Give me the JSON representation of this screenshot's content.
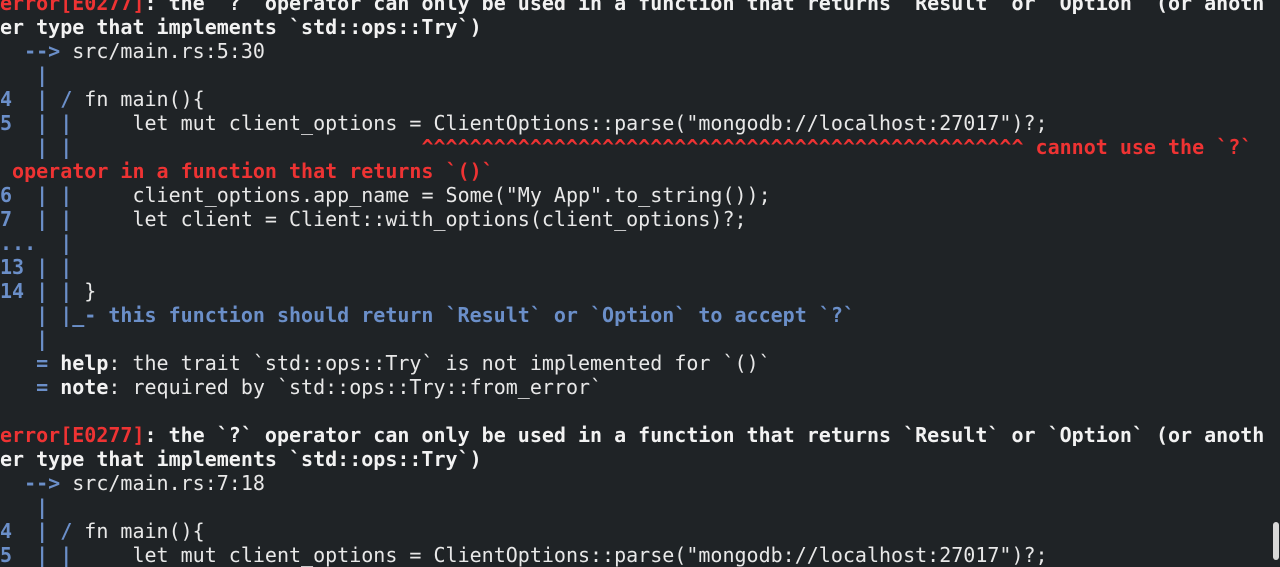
{
  "colors": {
    "background": "#1f2326",
    "error": "#ee3333",
    "gutter": "#6b8fc9",
    "text": "#e8e8e8"
  },
  "terminal": {
    "lines": [
      {
        "segments": [
          {
            "t": "error[E0277]",
            "s": "err"
          },
          {
            "t": ": the `?` operator can only be used in a function that returns `Result` or `Option` (or anoth",
            "s": "bold"
          }
        ]
      },
      {
        "segments": [
          {
            "t": "er type that implements `std::ops::Try`)",
            "s": "bold"
          }
        ]
      },
      {
        "segments": [
          {
            "t": "  --> ",
            "s": "blue"
          },
          {
            "t": "src/main.rs:5:30",
            "s": "text"
          }
        ]
      },
      {
        "segments": [
          {
            "t": "   |",
            "s": "blue"
          }
        ]
      },
      {
        "segments": [
          {
            "t": "4  | / ",
            "s": "blue"
          },
          {
            "t": "fn main(){",
            "s": "text"
          }
        ]
      },
      {
        "segments": [
          {
            "t": "5  | | ",
            "s": "blue"
          },
          {
            "t": "    let mut client_options = ClientOptions::parse(\"mongodb://localhost:27017\")?;",
            "s": "text"
          }
        ]
      },
      {
        "segments": [
          {
            "t": "   | | ",
            "s": "blue"
          },
          {
            "t": "                            ^^^^^^^^^^^^^^^^^^^^^^^^^^^^^^^^^^^^^^^^^^^^^^^^^^ cannot use the `?`",
            "s": "err"
          }
        ]
      },
      {
        "segments": [
          {
            "t": " operator in a function that returns `()`",
            "s": "err"
          }
        ]
      },
      {
        "segments": [
          {
            "t": "6  | | ",
            "s": "blue"
          },
          {
            "t": "    client_options.app_name = Some(\"My App\".to_string());",
            "s": "text"
          }
        ]
      },
      {
        "segments": [
          {
            "t": "7  | | ",
            "s": "blue"
          },
          {
            "t": "    let client = Client::with_options(client_options)?;",
            "s": "text"
          }
        ]
      },
      {
        "segments": [
          {
            "t": "...  |",
            "s": "blue"
          }
        ]
      },
      {
        "segments": [
          {
            "t": "13 | |",
            "s": "blue"
          }
        ]
      },
      {
        "segments": [
          {
            "t": "14 | | ",
            "s": "blue"
          },
          {
            "t": "}",
            "s": "text"
          }
        ]
      },
      {
        "segments": [
          {
            "t": "   | |_- this function should return `Result` or `Option` to accept `?`",
            "s": "blue"
          }
        ]
      },
      {
        "segments": [
          {
            "t": "   |",
            "s": "blue"
          }
        ]
      },
      {
        "segments": [
          {
            "t": "   = ",
            "s": "blue"
          },
          {
            "t": "help",
            "s": "bold"
          },
          {
            "t": ": the trait `std::ops::Try` is not implemented for `()`",
            "s": "text"
          }
        ]
      },
      {
        "segments": [
          {
            "t": "   = ",
            "s": "blue"
          },
          {
            "t": "note",
            "s": "bold"
          },
          {
            "t": ": required by `std::ops::Try::from_error`",
            "s": "text"
          }
        ]
      },
      {
        "segments": []
      },
      {
        "segments": [
          {
            "t": "error[E0277]",
            "s": "err"
          },
          {
            "t": ": the `?` operator can only be used in a function that returns `Result` or `Option` (or anoth",
            "s": "bold"
          }
        ]
      },
      {
        "segments": [
          {
            "t": "er type that implements `std::ops::Try`)",
            "s": "bold"
          }
        ]
      },
      {
        "segments": [
          {
            "t": "  --> ",
            "s": "blue"
          },
          {
            "t": "src/main.rs:7:18",
            "s": "text"
          }
        ]
      },
      {
        "segments": [
          {
            "t": "   |",
            "s": "blue"
          }
        ]
      },
      {
        "segments": [
          {
            "t": "4  | / ",
            "s": "blue"
          },
          {
            "t": "fn main(){",
            "s": "text"
          }
        ]
      },
      {
        "segments": [
          {
            "t": "5  | | ",
            "s": "blue"
          },
          {
            "t": "    let mut client_options = ClientOptions::parse(\"mongodb://localhost:27017\")?;",
            "s": "text"
          }
        ]
      }
    ]
  }
}
